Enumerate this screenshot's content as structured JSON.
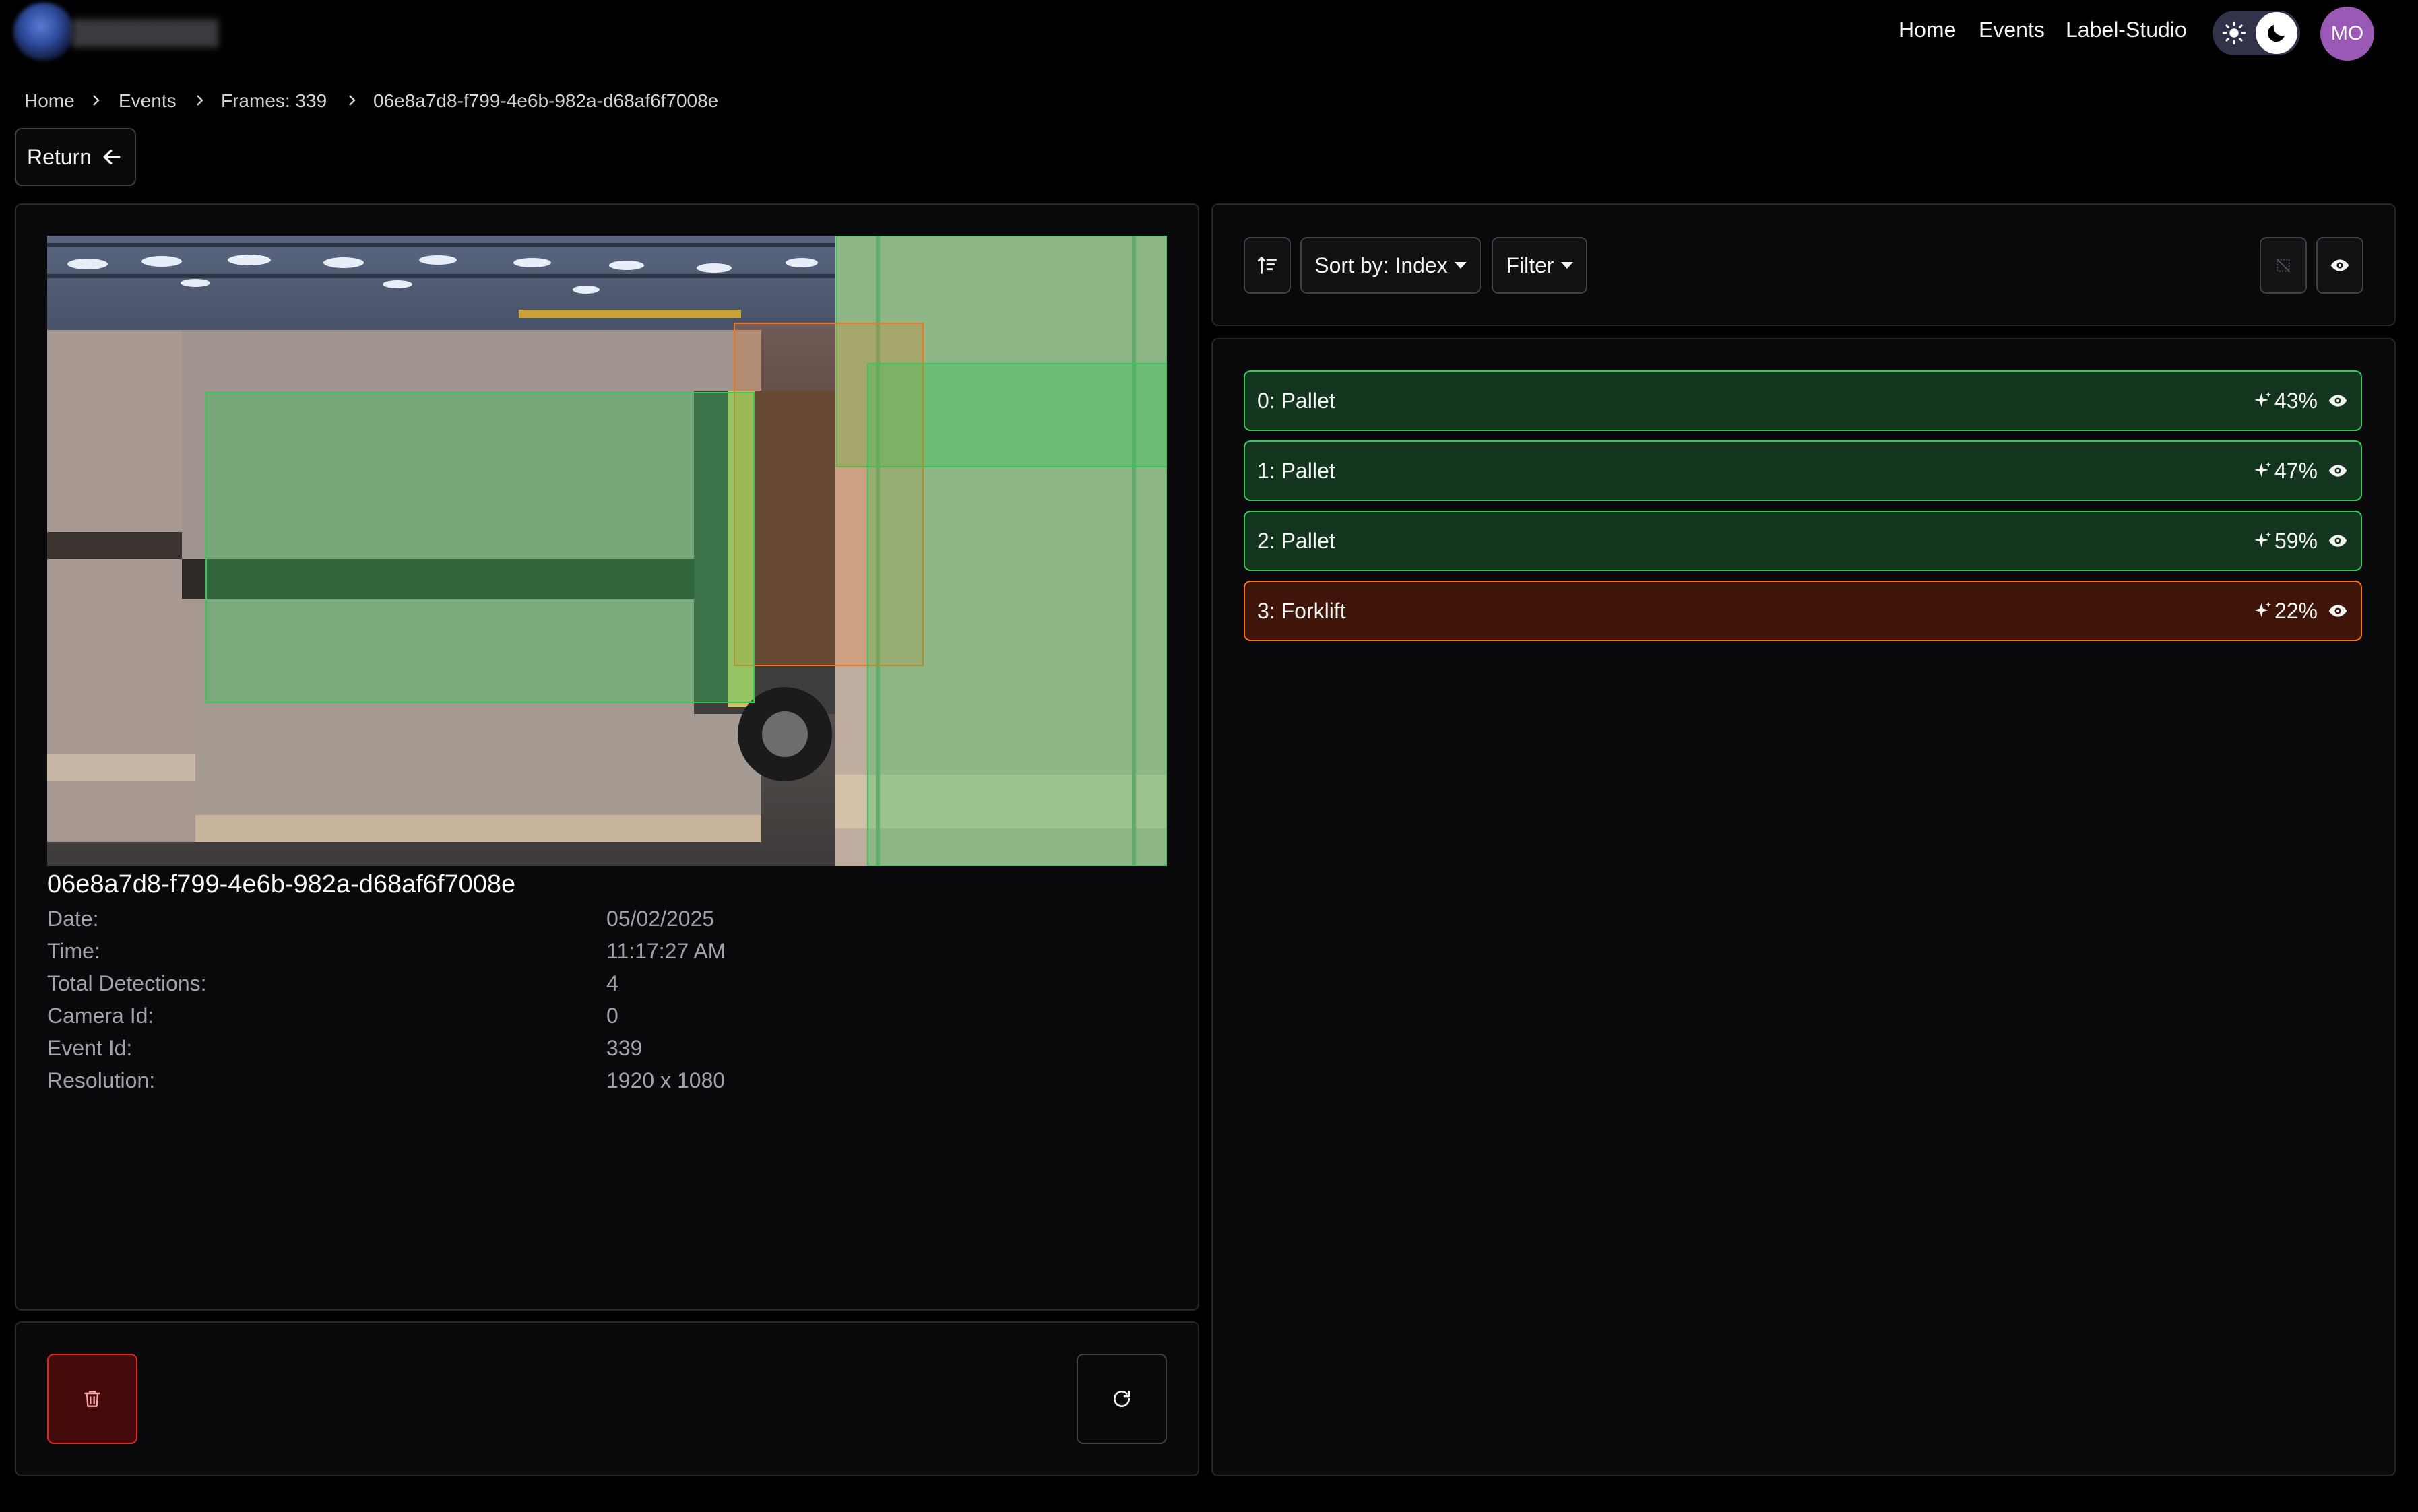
{
  "header": {
    "nav": [
      "Home",
      "Events",
      "Label-Studio"
    ],
    "avatar_initials": "MO"
  },
  "breadcrumb": [
    "Home",
    "Events",
    "Frames: 339",
    "06e8a7d8-f799-4e6b-982a-d68af6f7008e"
  ],
  "return_label": "Return",
  "frame": {
    "id": "06e8a7d8-f799-4e6b-982a-d68af6f7008e",
    "details": [
      {
        "label": "Date:",
        "value": "05/02/2025"
      },
      {
        "label": "Time:",
        "value": "11:17:27 AM"
      },
      {
        "label": "Total Detections:",
        "value": "4"
      },
      {
        "label": "Camera Id:",
        "value": "0"
      },
      {
        "label": "Event Id:",
        "value": "339"
      },
      {
        "label": "Resolution:",
        "value": "1920 x 1080"
      }
    ]
  },
  "toolbar": {
    "sort_label": "Sort by: Index",
    "filter_label": "Filter"
  },
  "detections": [
    {
      "label": "0: Pallet",
      "confidence": "43%",
      "class": "pallet",
      "color": "#34c759"
    },
    {
      "label": "1: Pallet",
      "confidence": "47%",
      "class": "pallet",
      "color": "#34c759"
    },
    {
      "label": "2: Pallet",
      "confidence": "59%",
      "class": "pallet",
      "color": "#34c759"
    },
    {
      "label": "3: Forklift",
      "confidence": "22%",
      "class": "forklift",
      "color": "#f97316"
    }
  ],
  "colors": {
    "background": "#000000",
    "panel": "#09090b",
    "pallet_box": "#34c759",
    "forklift_box": "#f97316",
    "delete": "#dc2626",
    "avatar": "#9b59b6"
  }
}
